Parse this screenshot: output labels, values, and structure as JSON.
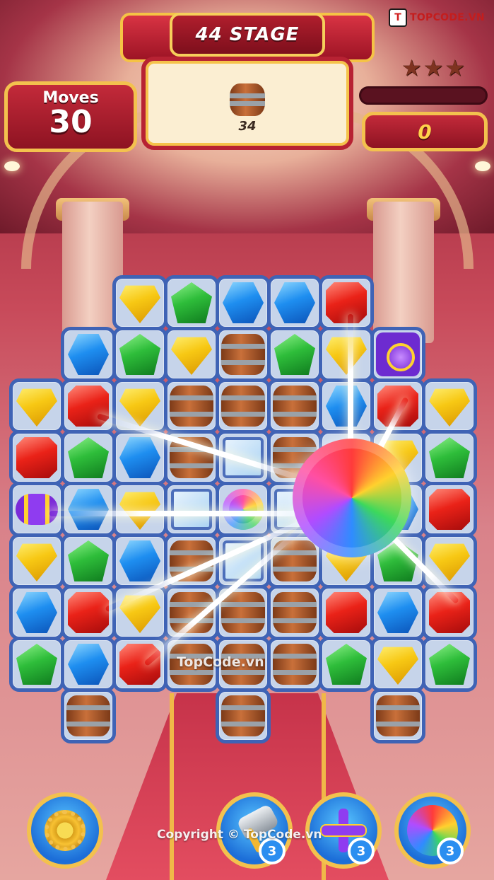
{
  "logo": {
    "mark": "T",
    "text": "TOPCODE.VN"
  },
  "stage": {
    "title": "44 STAGE",
    "goal_item": "barrel",
    "goal_count": "34"
  },
  "moves": {
    "label": "Moves",
    "value": "30"
  },
  "stars": {
    "earned": 0,
    "total": 3,
    "glyph": "★"
  },
  "score": {
    "value": "0",
    "progress": 0
  },
  "board": {
    "cols": 9,
    "rows": 9,
    "grid": [
      [
        "",
        "",
        "yellow",
        "green",
        "blue",
        "blue",
        "red",
        "",
        ""
      ],
      [
        "",
        "blue",
        "green",
        "yellow",
        "barrel",
        "green",
        "yellow",
        "bomb",
        ""
      ],
      [
        "yellow",
        "red",
        "yellow",
        "barrel",
        "barrel",
        "barrel",
        "blue",
        "red",
        "yellow"
      ],
      [
        "red",
        "green",
        "blue",
        "barrel",
        "ice",
        "barrel",
        "ball",
        "yellow",
        "green"
      ],
      [
        "rocket",
        "blue",
        "yellow",
        "ice",
        "flower",
        "ice",
        "ball",
        "blue",
        "red"
      ],
      [
        "yellow",
        "green",
        "blue",
        "barrel",
        "ice",
        "barrel",
        "yellow",
        "green",
        "yellow"
      ],
      [
        "blue",
        "red",
        "yellow",
        "barrel",
        "barrel",
        "barrel",
        "red",
        "blue",
        "red"
      ],
      [
        "green",
        "blue",
        "red",
        "barrel",
        "barrel",
        "barrel",
        "green",
        "yellow",
        "green"
      ],
      [
        "",
        "barrel",
        "",
        "",
        "barrel",
        "",
        "",
        "barrel",
        ""
      ]
    ]
  },
  "watermark": "TopCode.vn",
  "boosters": [
    {
      "name": "settings",
      "icon": "gear-icon",
      "count": ""
    },
    {
      "name": "hammer",
      "icon": "hammer-icon",
      "count": "3"
    },
    {
      "name": "cross",
      "icon": "cross-icon",
      "count": "3"
    },
    {
      "name": "color-ball",
      "icon": "rainbow-ball-icon",
      "count": "3"
    }
  ],
  "copyright": "Copyright © TopCode.vn",
  "colors": {
    "accent": "#f3c14e",
    "panel": "#b72233",
    "board_border": "#3f63b5"
  }
}
